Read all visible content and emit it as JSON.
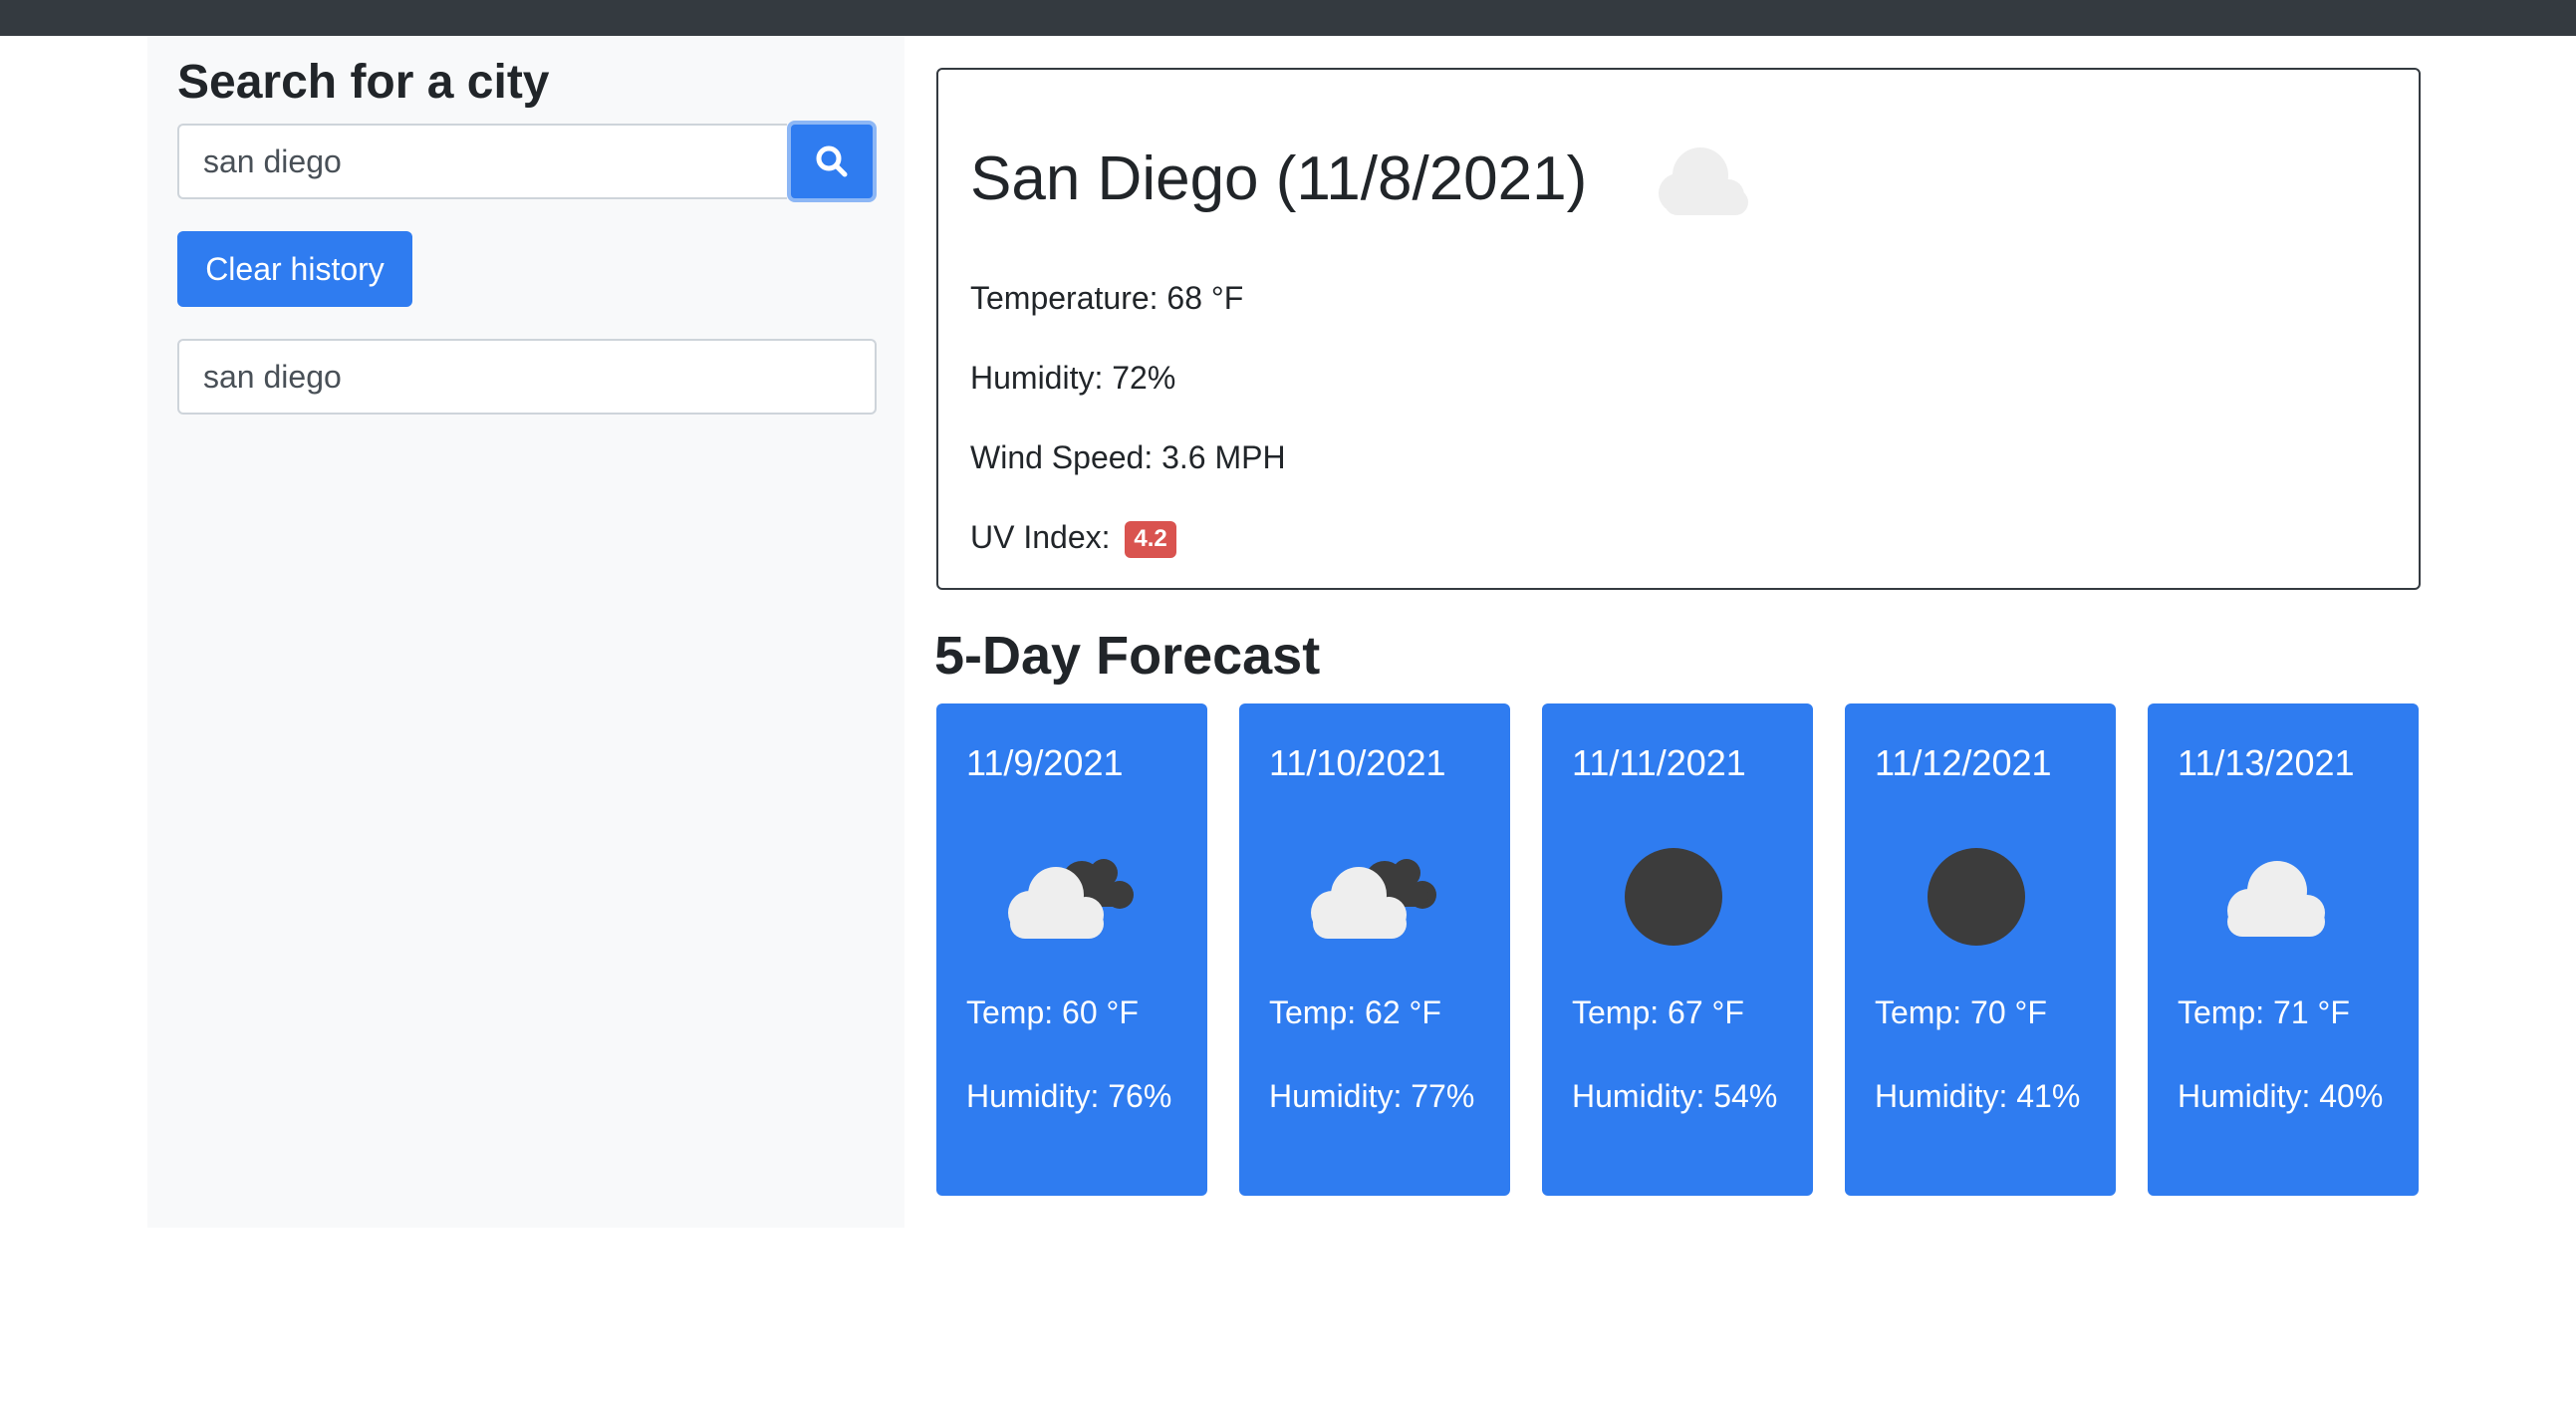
{
  "sidebar": {
    "title": "Search for a city",
    "search_value": "san diego",
    "clear_label": "Clear history",
    "history": [
      "san diego"
    ]
  },
  "current": {
    "heading": "San Diego (11/8/2021)",
    "icon": "clouds-icon",
    "temperature": "Temperature: 68 °F",
    "humidity": "Humidity: 72%",
    "wind": "Wind Speed: 3.6 MPH",
    "uv_label": "UV Index:",
    "uv_value": "4.2",
    "uv_color": "#d9534f"
  },
  "forecast": {
    "title": "5-Day Forecast",
    "days": [
      {
        "date": "11/9/2021",
        "icon": "broken-clouds-icon",
        "temp": "Temp: 60 °F",
        "humidity": "Humidity: 76%"
      },
      {
        "date": "11/10/2021",
        "icon": "broken-clouds-icon",
        "temp": "Temp: 62 °F",
        "humidity": "Humidity: 77%"
      },
      {
        "date": "11/11/2021",
        "icon": "clear-night-icon",
        "temp": "Temp: 67 °F",
        "humidity": "Humidity: 54%"
      },
      {
        "date": "11/12/2021",
        "icon": "clear-night-icon",
        "temp": "Temp: 70 °F",
        "humidity": "Humidity: 41%"
      },
      {
        "date": "11/13/2021",
        "icon": "clouds-icon",
        "temp": "Temp: 71 °F",
        "humidity": "Humidity: 40%"
      }
    ]
  },
  "colors": {
    "accent": "#2f7cf0",
    "topbar": "#343a40",
    "sidebar_bg": "#f8f9fa"
  }
}
